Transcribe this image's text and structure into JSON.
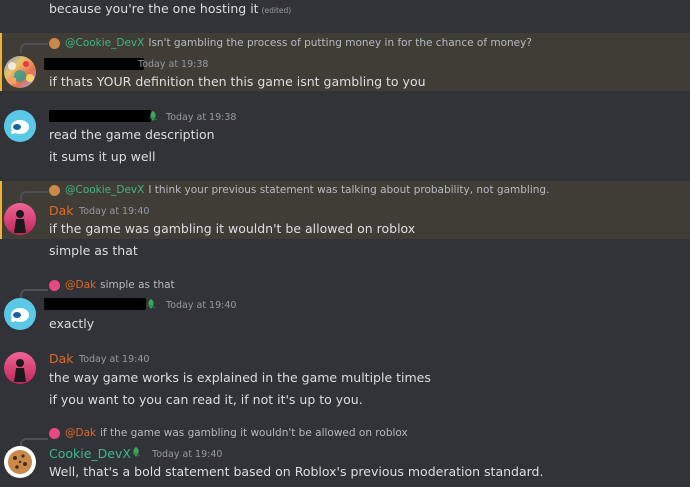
{
  "colors": {
    "background": "#313338",
    "highlight": "#403d37",
    "mention_bar": "#f0b232",
    "dak": "#e06a24",
    "cookie": "#3fb98b",
    "reply_mention": "#43b581"
  },
  "messages": {
    "m0": {
      "text": "because you're the one hosting it",
      "edited": "(edited)"
    },
    "m1": {
      "reply_mention": "@Cookie_DevX",
      "reply_text": "Isn't gambling the process of putting money in for the chance of money?",
      "timestamp": "Today at 19:38",
      "text": "if thats YOUR definition then this game isnt gambling to you"
    },
    "m2": {
      "timestamp": "Today at 19:38",
      "line1": "read the game description",
      "line2": "it sums it up well"
    },
    "m3": {
      "reply_mention": "@Cookie_DevX",
      "reply_text": "I think your previous statement was talking about probability, not gambling.",
      "author": "Dak",
      "timestamp": "Today at 19:40",
      "line1": "if the game was gambling it wouldn't be allowed on roblox",
      "line2": "simple as that"
    },
    "m4": {
      "reply_mention": "@Dak",
      "reply_text": "simple as that",
      "timestamp": "Today at 19:40",
      "text": "exactly"
    },
    "m5": {
      "author": "Dak",
      "timestamp": "Today at 19:40",
      "line1": "the way game works is explained in the game multiple times",
      "line2": "if you want to you can read it, if not it's up to you."
    },
    "m6": {
      "reply_mention": "@Dak",
      "reply_text": "if the game was gambling it wouldn't be allowed on roblox",
      "author": "Cookie_DevX",
      "timestamp": "Today at 19:40",
      "text": "Well, that's a bold statement based on Roblox's previous moderation standard."
    }
  },
  "icons": {
    "verified": "leaf-badge-icon",
    "cookie": "cookie-icon"
  }
}
